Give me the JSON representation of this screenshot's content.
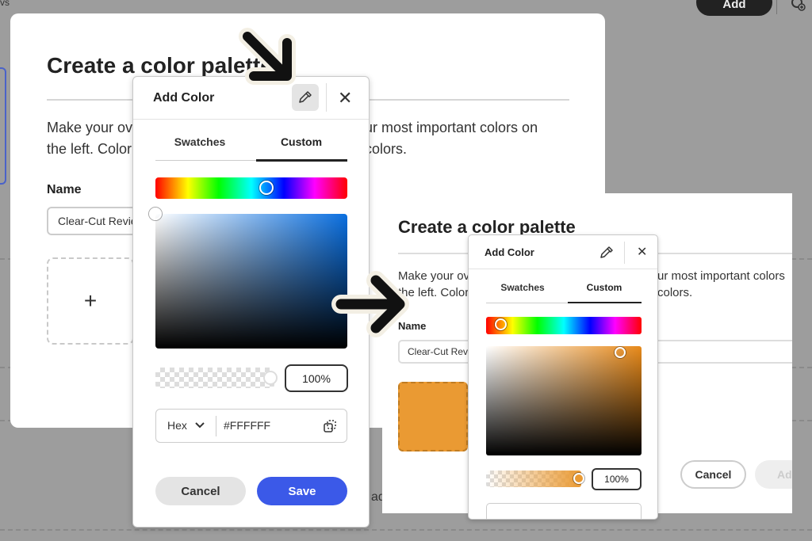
{
  "background": {
    "topbar_fragment": "vs",
    "add_button": "Add",
    "settings_icon": "gear-plus-icon"
  },
  "dialog": {
    "title": "Create a color palette",
    "desc_line1_start": "Make your ov",
    "desc_line1_end": "ur most important colors on",
    "desc_line2_start": "the left. Color",
    "desc_line2_end": "colors.",
    "name_label": "Name",
    "name_value": "Clear-Cut Revie",
    "add_tile_symbol": "+",
    "stray_text": "ad"
  },
  "color_popover": {
    "title": "Add Color",
    "eyedropper_icon": "eyedropper-icon",
    "close_symbol": "✕",
    "tabs": [
      {
        "label": "Swatches",
        "selected": false
      },
      {
        "label": "Custom",
        "selected": true
      }
    ],
    "hue_position_pct": 58,
    "alpha_percent": "100%",
    "format": "Hex",
    "hex_value": "#FFFFFF",
    "cancel_label": "Cancel",
    "save_label": "Save",
    "colors": {
      "accent": "#3b59e8",
      "hue_color": "#0a6fe0"
    }
  },
  "inset": {
    "title": "Create a color palette",
    "desc_line1_start": "Make your ov",
    "desc_line1_end": "ur most important colors",
    "desc_line2_start": "the left. Color",
    "desc_line2_end": "colors.",
    "name_label": "Name",
    "name_value": "Clear-Cut Revie",
    "swatch_color": "#ea9a33",
    "cancel_label": "Cancel",
    "add_label": "Ad",
    "popover": {
      "title": "Add Color",
      "close_symbol": "✕",
      "tabs": [
        {
          "label": "Swatches",
          "selected": false
        },
        {
          "label": "Custom",
          "selected": true
        }
      ],
      "hue_position_pct": 9,
      "alpha_percent": "100%"
    }
  }
}
